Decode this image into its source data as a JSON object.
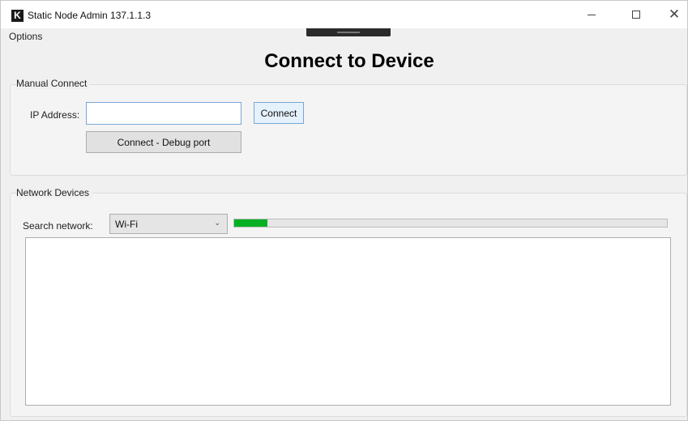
{
  "window": {
    "title": "Static Node Admin 137.1.1.3",
    "logo_letter": "K"
  },
  "menu": {
    "options_label": "Options"
  },
  "page": {
    "title": "Connect to Device"
  },
  "manual_connect": {
    "group_label": "Manual Connect",
    "ip_label": "IP Address:",
    "ip_value": "",
    "connect_label": "Connect",
    "debug_label": "Connect - Debug port"
  },
  "network_devices": {
    "group_label": "Network Devices",
    "search_label": "Search network:",
    "selected_network": "Wi-Fi",
    "progress_percent": 7.6,
    "progress_color": "#06b025",
    "devices": []
  }
}
